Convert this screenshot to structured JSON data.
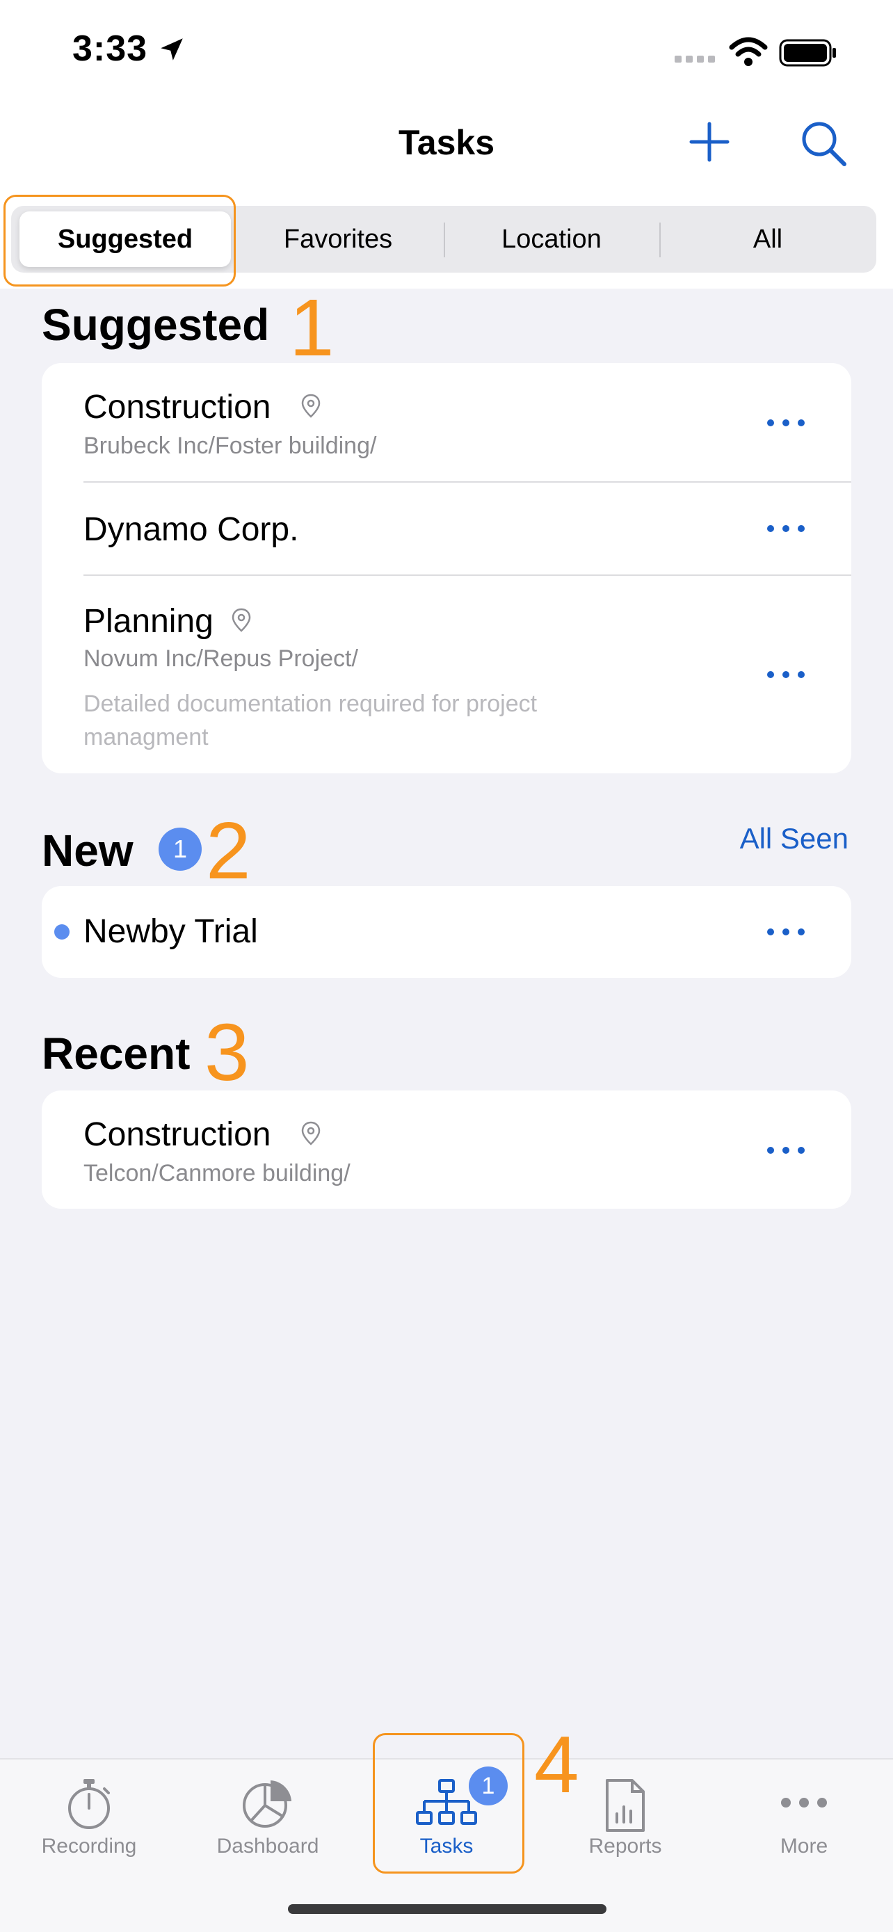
{
  "status": {
    "time": "3:33"
  },
  "nav": {
    "title": "Tasks"
  },
  "segments": [
    {
      "label": "Suggested",
      "selected": true
    },
    {
      "label": "Favorites",
      "selected": false
    },
    {
      "label": "Location",
      "selected": false
    },
    {
      "label": "All",
      "selected": false
    }
  ],
  "annotations": {
    "one": "1",
    "two": "2",
    "three": "3",
    "four": "4"
  },
  "suggested": {
    "title": "Suggested",
    "items": [
      {
        "title": "Construction",
        "path": "Brubeck Inc/Foster building/"
      },
      {
        "title": "Dynamo Corp."
      },
      {
        "title": "Planning",
        "path": "Novum Inc/Repus Project/",
        "description": "Detailed documentation required for project managment"
      }
    ]
  },
  "new": {
    "title": "New",
    "badge": "1",
    "all_seen": "All Seen",
    "items": [
      {
        "title": "Newby Trial"
      }
    ]
  },
  "recent": {
    "title": "Recent",
    "items": [
      {
        "title": "Construction",
        "path": "Telcon/Canmore building/"
      }
    ]
  },
  "tabbar": {
    "items": [
      {
        "label": "Recording",
        "icon": "stopwatch-icon"
      },
      {
        "label": "Dashboard",
        "icon": "pie-chart-icon"
      },
      {
        "label": "Tasks",
        "icon": "hierarchy-icon",
        "badge": "1",
        "active": true
      },
      {
        "label": "Reports",
        "icon": "report-document-icon"
      },
      {
        "label": "More",
        "icon": "ellipsis-icon"
      }
    ]
  },
  "colors": {
    "accent": "#1a5fc8",
    "badge": "#5b8def",
    "annotation": "#f7941e",
    "background": "#f2f2f7"
  }
}
